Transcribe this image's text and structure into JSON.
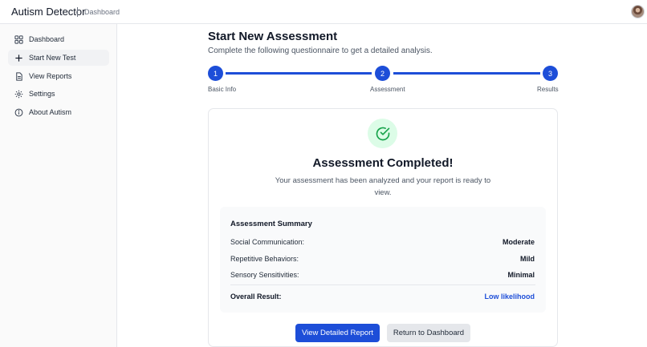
{
  "header": {
    "app_title": "Autism Detector",
    "breadcrumb": "Dashboard",
    "avatar_icon": "user-avatar"
  },
  "sidebar": {
    "items": [
      {
        "label": "Dashboard",
        "icon": "grid-icon",
        "active": false
      },
      {
        "label": "Start New Test",
        "icon": "plus-icon",
        "active": true
      },
      {
        "label": "View Reports",
        "icon": "document-icon",
        "active": false
      },
      {
        "label": "Settings",
        "icon": "gear-icon",
        "active": false
      },
      {
        "label": "About Autism",
        "icon": "info-icon",
        "active": false
      }
    ]
  },
  "main": {
    "title": "Start New Assessment",
    "subtitle": "Complete the following questionnaire to get a detailed analysis.",
    "steps": [
      {
        "number": "1",
        "label": "Basic Info"
      },
      {
        "number": "2",
        "label": "Assessment"
      },
      {
        "number": "3",
        "label": "Results"
      }
    ],
    "result_card": {
      "icon": "check-circle-icon",
      "title": "Assessment Completed!",
      "message": "Your assessment has been analyzed and your report is ready to view.",
      "summary": {
        "title": "Assessment Summary",
        "rows": [
          {
            "label": "Social Communication:",
            "value": "Moderate"
          },
          {
            "label": "Repetitive Behaviors:",
            "value": "Mild"
          },
          {
            "label": "Sensory Sensitivities:",
            "value": "Minimal"
          }
        ],
        "overall_label": "Overall Result:",
        "overall_value": "Low likelihood"
      },
      "primary_button": "View Detailed Report",
      "secondary_button": "Return to Dashboard"
    }
  },
  "colors": {
    "accent": "#1d4ed8",
    "success_bg": "#dcfce7",
    "success": "#16a34a"
  }
}
